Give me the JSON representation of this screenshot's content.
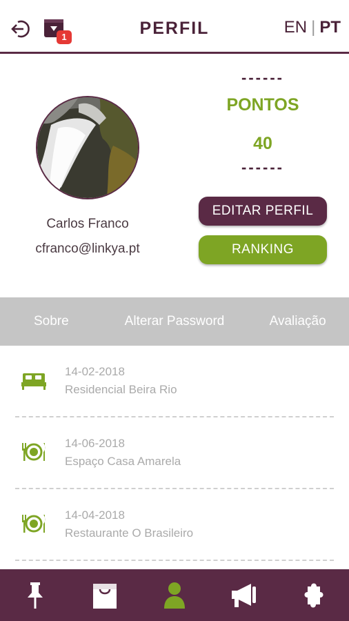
{
  "header": {
    "title": "PERFIL",
    "notification_count": "1",
    "languages": [
      {
        "label": "EN",
        "active": false
      },
      {
        "label": "PT",
        "active": true
      }
    ],
    "lang_separator": "|"
  },
  "profile": {
    "name": "Carlos Franco",
    "email": "cfranco@linkya.pt",
    "points_label": "PONTOS",
    "points_value": "40",
    "dashes": "------"
  },
  "buttons": {
    "edit_profile": "EDITAR PERFIL",
    "ranking": "RANKING"
  },
  "tabs": [
    {
      "label": "Sobre"
    },
    {
      "label": "Alterar Password"
    },
    {
      "label": "Avaliação"
    }
  ],
  "history": [
    {
      "icon": "bed-icon",
      "date": "14-02-2018",
      "place": "Residencial Beira Rio"
    },
    {
      "icon": "restaurant-icon",
      "date": "14-06-2018",
      "place": "Espaço Casa Amarela"
    },
    {
      "icon": "restaurant-icon",
      "date": "14-04-2018",
      "place": "Restaurante O Brasileiro"
    }
  ],
  "bottom_nav": [
    {
      "icon": "pin-icon",
      "active": false
    },
    {
      "icon": "shop-icon",
      "active": false
    },
    {
      "icon": "user-icon",
      "active": true
    },
    {
      "icon": "megaphone-icon",
      "active": false
    },
    {
      "icon": "puzzle-icon",
      "active": false
    }
  ],
  "colors": {
    "brand": "#5a2a45",
    "accent": "#7ea524",
    "tab_bar": "#c5c5c5",
    "badge": "#e53935"
  }
}
